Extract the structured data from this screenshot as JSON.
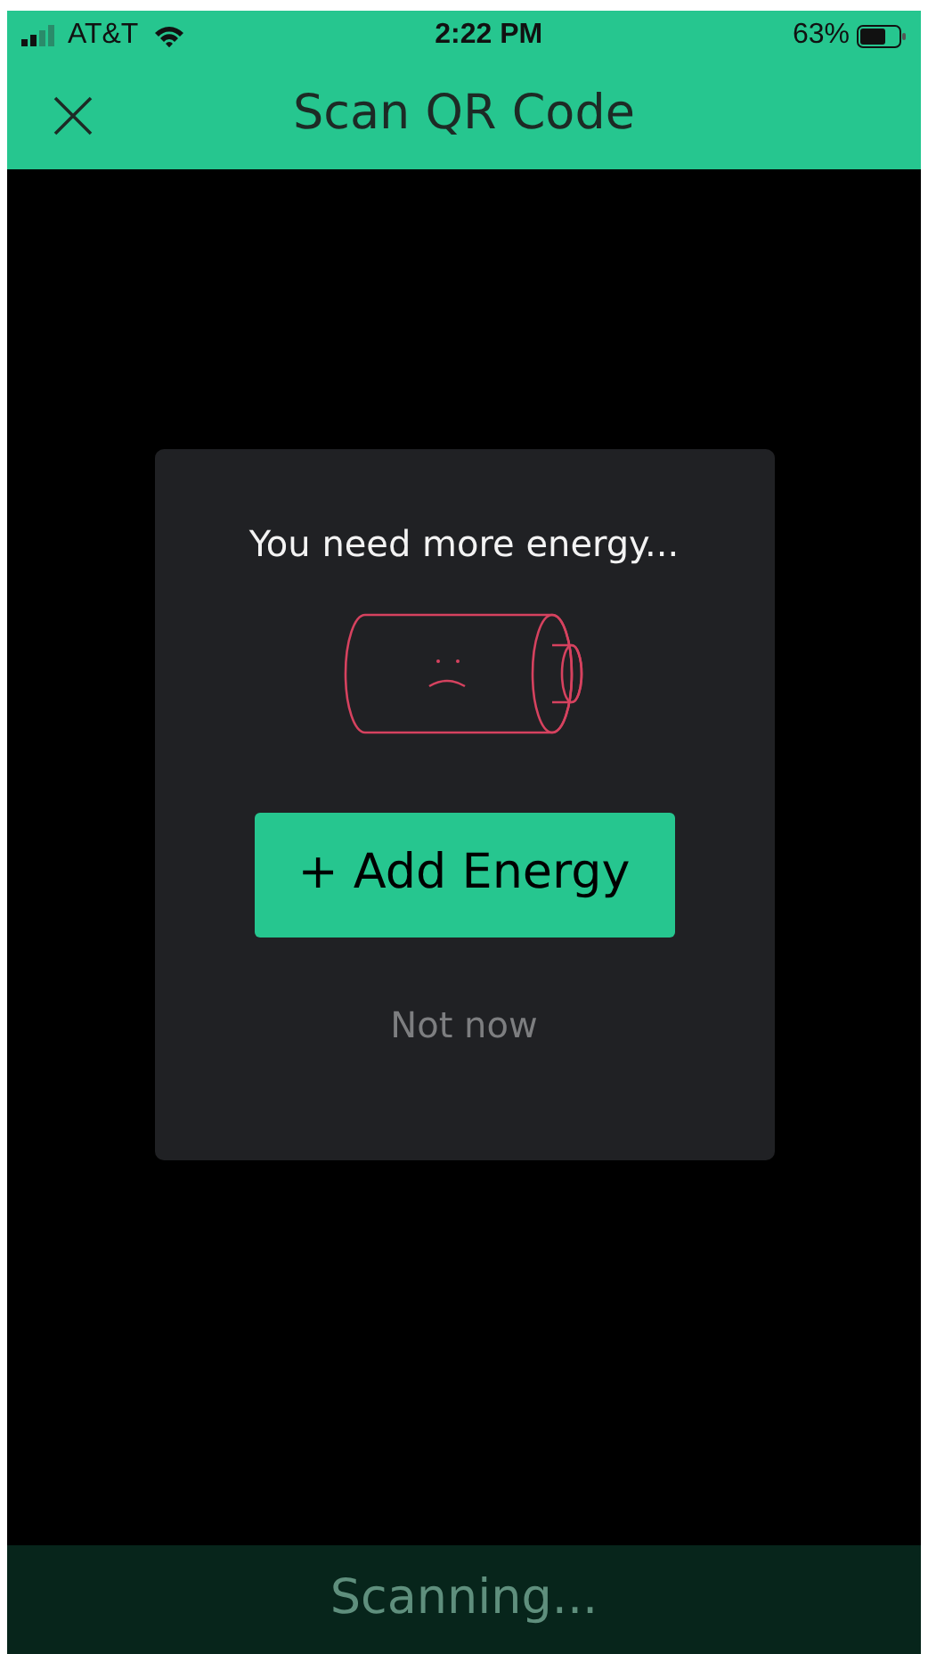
{
  "status_bar": {
    "carrier": "AT&T",
    "time": "2:22 PM",
    "battery": "63%"
  },
  "header": {
    "title": "Scan QR Code"
  },
  "dialog": {
    "message": "You need more energy...",
    "primary_button": "+ Add Energy",
    "secondary_button": "Not now"
  },
  "footer": {
    "status": "Scanning..."
  }
}
